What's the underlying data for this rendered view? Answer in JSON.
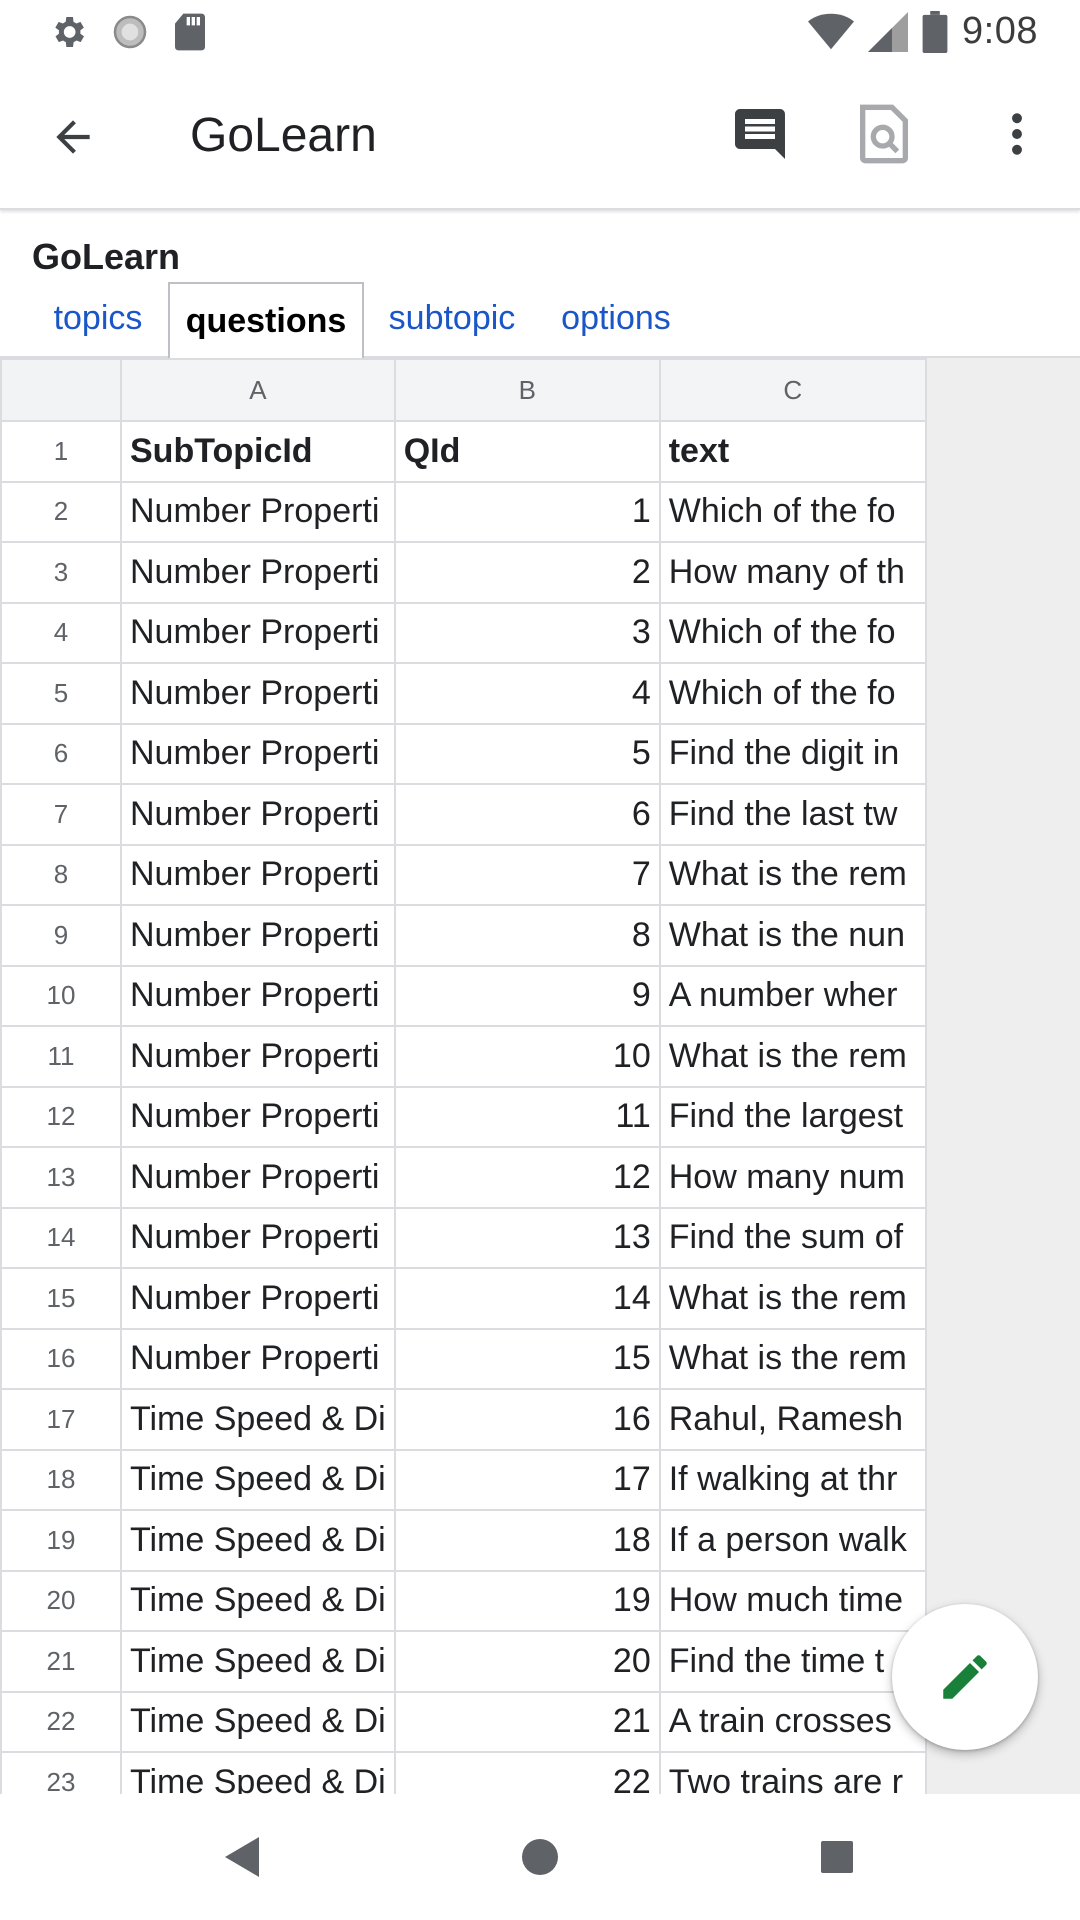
{
  "status_bar": {
    "time": "9:08",
    "left_icons": [
      "settings-icon",
      "sync-icon",
      "sd-card-icon"
    ],
    "right_icons": [
      "wifi-icon",
      "signal-icon",
      "battery-icon"
    ]
  },
  "app_bar": {
    "title": "GoLearn",
    "actions": [
      "comments-icon",
      "preview-icon",
      "more-vert-icon"
    ]
  },
  "document": {
    "title": "GoLearn"
  },
  "tabs": [
    {
      "label": "topics",
      "active": false
    },
    {
      "label": "questions",
      "active": true
    },
    {
      "label": "subtopic",
      "active": false
    },
    {
      "label": "options",
      "active": false
    }
  ],
  "grid": {
    "columns": [
      "A",
      "B",
      "C"
    ],
    "header_row": {
      "row": "1",
      "A": "SubTopicId",
      "B": "QId",
      "C": "text"
    },
    "rows": [
      {
        "row": "2",
        "A": "Number Properti",
        "B": "1",
        "C": "Which of the fo"
      },
      {
        "row": "3",
        "A": "Number Properti",
        "B": "2",
        "C": "How many of th"
      },
      {
        "row": "4",
        "A": "Number Properti",
        "B": "3",
        "C": "Which of the fo"
      },
      {
        "row": "5",
        "A": "Number Properti",
        "B": "4",
        "C": "Which of the fo"
      },
      {
        "row": "6",
        "A": "Number Properti",
        "B": "5",
        "C": "Find the digit in"
      },
      {
        "row": "7",
        "A": "Number Properti",
        "B": "6",
        "C": "Find the last tw"
      },
      {
        "row": "8",
        "A": "Number Properti",
        "B": "7",
        "C": "What is the rem"
      },
      {
        "row": "9",
        "A": "Number Properti",
        "B": "8",
        "C": "What is the nun"
      },
      {
        "row": "10",
        "A": "Number Properti",
        "B": "9",
        "C": "A number wher"
      },
      {
        "row": "11",
        "A": "Number Properti",
        "B": "10",
        "C": "What is the rem"
      },
      {
        "row": "12",
        "A": "Number Properti",
        "B": "11",
        "C": "Find the largest"
      },
      {
        "row": "13",
        "A": "Number Properti",
        "B": "12",
        "C": "How many num"
      },
      {
        "row": "14",
        "A": "Number Properti",
        "B": "13",
        "C": "Find the sum of"
      },
      {
        "row": "15",
        "A": "Number Properti",
        "B": "14",
        "C": "What is the rem"
      },
      {
        "row": "16",
        "A": "Number Properti",
        "B": "15",
        "C": "What is the rem"
      },
      {
        "row": "17",
        "A": "Time Speed & Di",
        "B": "16",
        "C": "Rahul, Ramesh"
      },
      {
        "row": "18",
        "A": "Time Speed & Di",
        "B": "17",
        "C": "If walking at thr"
      },
      {
        "row": "19",
        "A": "Time Speed & Di",
        "B": "18",
        "C": "If a person walk"
      },
      {
        "row": "20",
        "A": "Time Speed & Di",
        "B": "19",
        "C": "How much time"
      },
      {
        "row": "21",
        "A": "Time Speed & Di",
        "B": "20",
        "C": "Find the time t"
      },
      {
        "row": "22",
        "A": "Time Speed & Di",
        "B": "21",
        "C": "A train crosses"
      },
      {
        "row": "23",
        "A": "Time Speed & Di",
        "B": "22",
        "C": "Two trains are r"
      }
    ]
  },
  "fab": {
    "icon": "edit-pencil-icon",
    "color": "#188038"
  },
  "nav_bar": {
    "buttons": [
      "back-triangle-icon",
      "home-circle-icon",
      "recents-square-icon"
    ]
  }
}
